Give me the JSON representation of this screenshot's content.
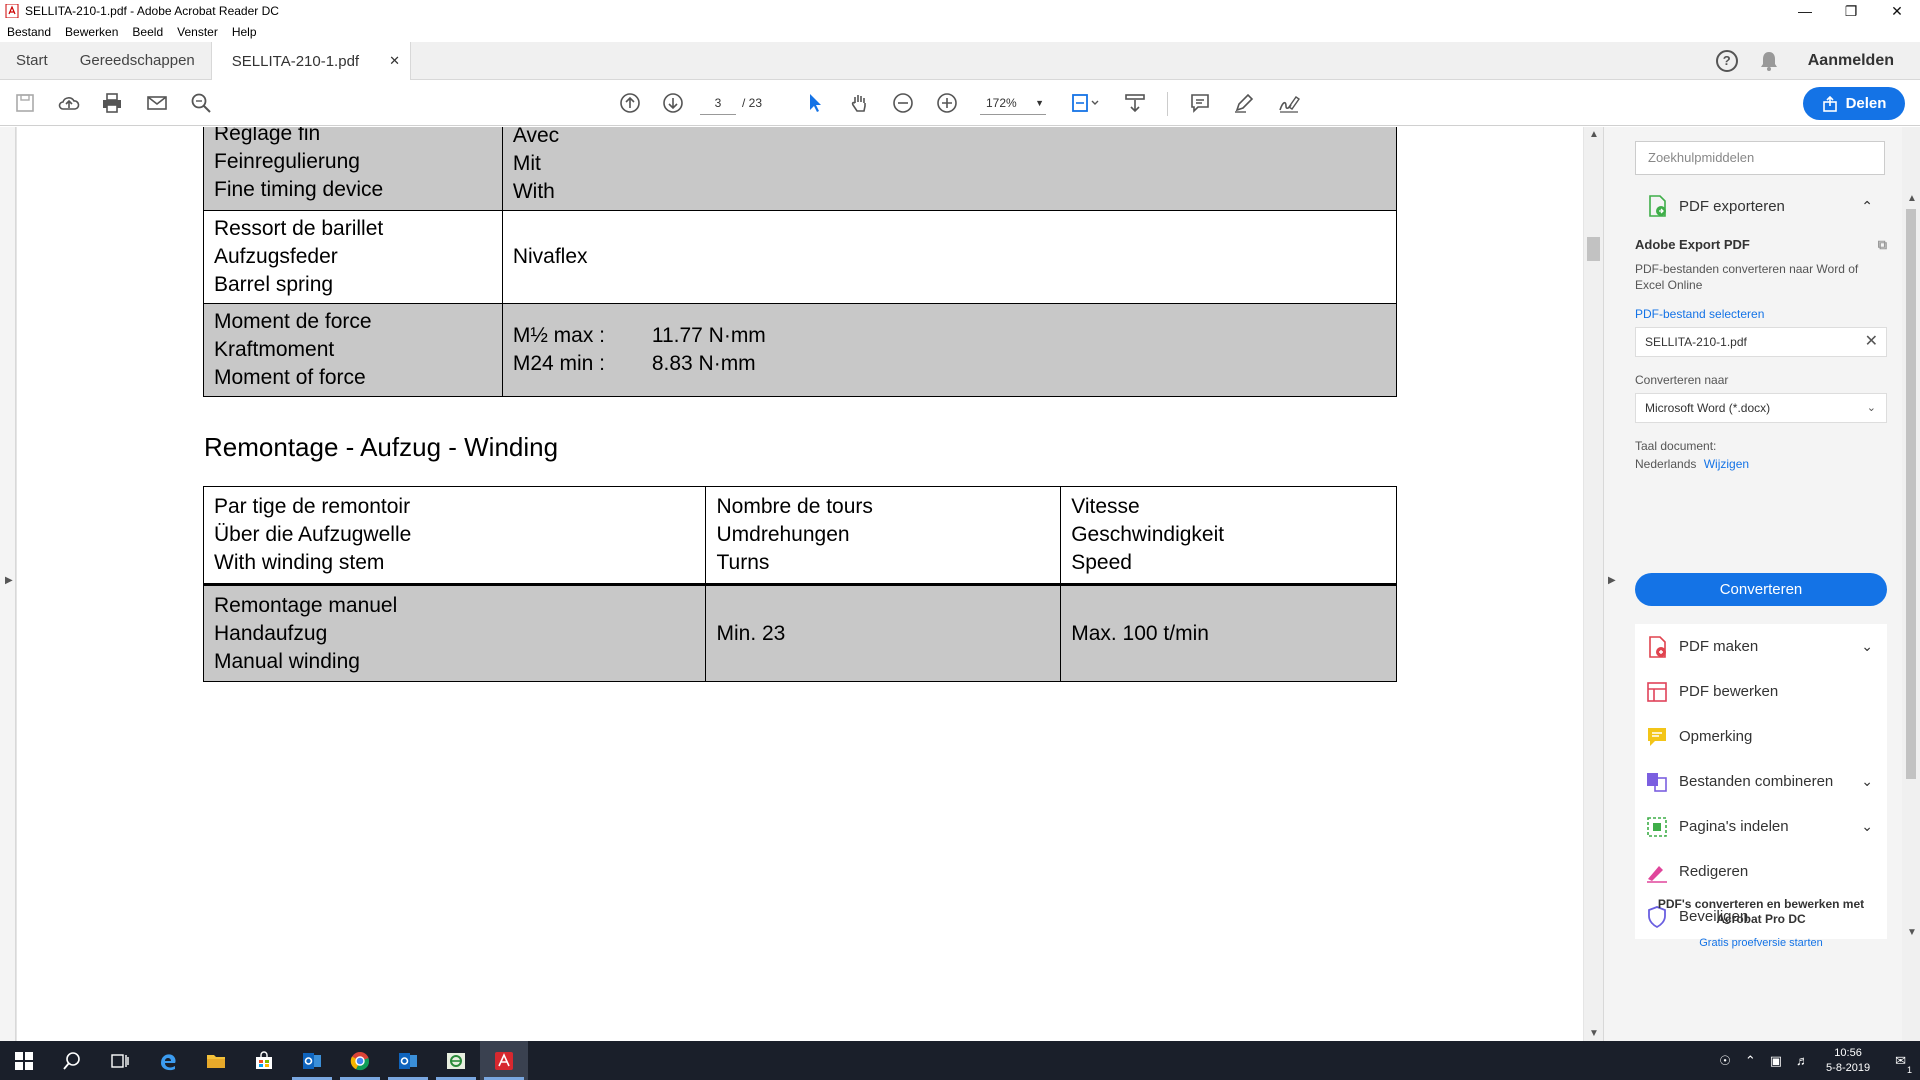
{
  "window": {
    "title": "SELLITA-210-1.pdf - Adobe Acrobat Reader DC"
  },
  "menu": [
    "Bestand",
    "Bewerken",
    "Beeld",
    "Venster",
    "Help"
  ],
  "tabs": {
    "start": "Start",
    "tools": "Gereedschappen",
    "document": "SELLITA-210-1.pdf",
    "signin": "Aanmelden",
    "help": "?"
  },
  "toolbar": {
    "current_page": "3",
    "page_separator": "/ 23",
    "zoom": "172%",
    "share_label": "Delen"
  },
  "document": {
    "table1": [
      {
        "left": [
          "Réglage fin",
          "Feinregulierung",
          "Fine timing device"
        ],
        "right": [
          "Avec",
          "Mit",
          "With"
        ],
        "grey": true
      },
      {
        "left": [
          "Ressort de barillet",
          "Aufzugsfeder",
          "Barrel spring"
        ],
        "right": [
          "Nivaflex"
        ],
        "grey": false
      },
      {
        "left": [
          "Moment de force",
          "Kraftmoment",
          "Moment of force"
        ],
        "moments": [
          {
            "k": "M½ max :",
            "v": "11.77 N·mm"
          },
          {
            "k": "M24 min :",
            "v": "8.83 N·mm"
          }
        ],
        "grey": true
      }
    ],
    "heading": "Remontage - Aufzug - Winding",
    "table2": {
      "header": [
        [
          "Par tige de remontoir",
          "Über die Aufzugwelle",
          "With winding stem"
        ],
        [
          "Nombre de tours",
          "Umdrehungen",
          "Turns"
        ],
        [
          "Vitesse",
          "Geschwindigkeit",
          "Speed"
        ]
      ],
      "row": {
        "label": [
          "Remontage manuel",
          "Handaufzug",
          "Manual winding"
        ],
        "turns": "Min. 23",
        "speed": "Max. 100 t/min"
      }
    }
  },
  "right_panel": {
    "search_placeholder": "Zoekhulpmiddelen",
    "export_header": "PDF exporteren",
    "export_title": "Adobe Export PDF",
    "export_desc": "PDF-bestanden converteren naar Word of Excel Online",
    "select_file_link": "PDF-bestand selecteren",
    "file_name": "SELLITA-210-1.pdf",
    "convert_to_label": "Converteren naar",
    "convert_to_value": "Microsoft Word (*.docx)",
    "language_label": "Taal document:",
    "language_value": "Nederlands",
    "language_change": "Wijzigen",
    "convert_button": "Converteren",
    "tools": [
      {
        "label": "PDF maken",
        "chevron": true,
        "color": "#e0434e"
      },
      {
        "label": "PDF bewerken",
        "chevron": false,
        "color": "#e0435a"
      },
      {
        "label": "Opmerking",
        "chevron": false,
        "color": "#f3c518"
      },
      {
        "label": "Bestanden combineren",
        "chevron": true,
        "color": "#7b5fe0"
      },
      {
        "label": "Pagina's indelen",
        "chevron": true,
        "color": "#3fae49"
      },
      {
        "label": "Redigeren",
        "chevron": false,
        "color": "#e0459b"
      },
      {
        "label": "Beveiligen",
        "chevron": false,
        "color": "#6a5fe0"
      }
    ],
    "promo_text": "PDF's converteren en bewerken met Acrobat Pro DC",
    "promo_link": "Gratis proefversie starten"
  },
  "taskbar": {
    "time": "10:56",
    "date": "5-8-2019",
    "notification_count": "1"
  },
  "colors": {
    "accent": "#1473e6",
    "table_grey": "#c8c8c8",
    "taskbar": "#1a1f2a"
  }
}
